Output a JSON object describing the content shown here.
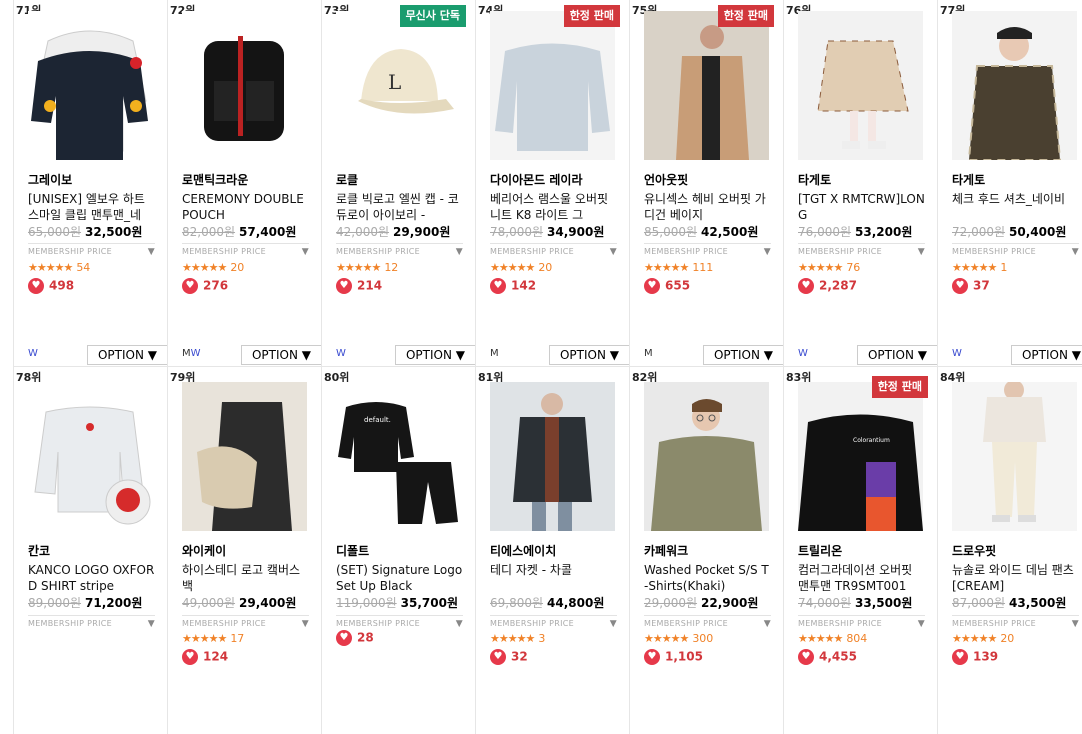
{
  "membership_label": "MEMBERSHIP PRICE",
  "option_label": "OPTION ▼",
  "row1": [
    {
      "rank": "71위",
      "brand": "그레이보",
      "name": "[UNISEX] 엘보우 하트 스마일 클립 맨투맨_네",
      "old_price": "65,000원",
      "price": "32,500원",
      "stars": "★★★★★",
      "rating_count": "54",
      "likes": "498",
      "badge": "",
      "gender_m": "",
      "gender_w": "W"
    },
    {
      "rank": "72위",
      "brand": "로맨틱크라운",
      "name": "CEREMONY DOUBLE POUCH",
      "old_price": "82,000원",
      "price": "57,400원",
      "stars": "★★★★★",
      "rating_count": "20",
      "likes": "276",
      "badge": "",
      "gender_m": "M",
      "gender_w": "W"
    },
    {
      "rank": "73위",
      "brand": "로클",
      "name": "로클 빅로고 엘씬 캡 - 코듀로이 아이보리 -",
      "old_price": "42,000원",
      "price": "29,900원",
      "stars": "★★★★★",
      "rating_count": "12",
      "likes": "214",
      "badge": "무신사 단독",
      "gender_m": "",
      "gender_w": "W"
    },
    {
      "rank": "74위",
      "brand": "다이아몬드 레이라",
      "name": "베리어스 램스울 오버핏 니트 K8 라이트 그",
      "old_price": "78,000원",
      "price": "34,900원",
      "stars": "★★★★★",
      "rating_count": "20",
      "likes": "142",
      "badge": "한정 판매",
      "gender_m": "M",
      "gender_w": ""
    },
    {
      "rank": "75위",
      "brand": "언아웃핏",
      "name": "유니섹스 헤비 오버핏 가디건 베이지",
      "old_price": "85,000원",
      "price": "42,500원",
      "stars": "★★★★★",
      "rating_count": "111",
      "likes": "655",
      "badge": "한정 판매",
      "gender_m": "M",
      "gender_w": ""
    },
    {
      "rank": "76위",
      "brand": "타게토",
      "name": "[TGT X RMTCRW]LONG",
      "old_price": "76,000원",
      "price": "53,200원",
      "stars": "★★★★★",
      "rating_count": "76",
      "likes": "2,287",
      "badge": "",
      "gender_m": "",
      "gender_w": "W"
    },
    {
      "rank": "77위",
      "brand": "타게토",
      "name": "체크 후드 셔츠_네이비",
      "old_price": "72,000원",
      "price": "50,400원",
      "stars": "★★★★★",
      "rating_count": "1",
      "likes": "37",
      "badge": "",
      "gender_m": "",
      "gender_w": "W"
    }
  ],
  "row2": [
    {
      "rank": "78위",
      "brand": "칸코",
      "name": "KANCO LOGO OXFORD SHIRT stripe",
      "old_price": "89,000원",
      "price": "71,200원",
      "stars": "",
      "rating_count": "",
      "likes": "",
      "badge": ""
    },
    {
      "rank": "79위",
      "brand": "와이케이",
      "name": "하이스테디 로고 캨버스 백",
      "old_price": "49,000원",
      "price": "29,400원",
      "stars": "★★★★★",
      "rating_count": "17",
      "likes": "124",
      "badge": ""
    },
    {
      "rank": "80위",
      "brand": "디폴트",
      "name": "(SET) Signature Logo Set Up Black",
      "old_price": "119,000원",
      "price": "35,700원",
      "stars": "",
      "rating_count": "",
      "likes": "28",
      "badge": ""
    },
    {
      "rank": "81위",
      "brand": "티에스에이치",
      "name": "테디 자켓 - 차콜",
      "old_price": "69,800원",
      "price": "44,800원",
      "stars": "★★★★★",
      "rating_count": "3",
      "likes": "32",
      "badge": ""
    },
    {
      "rank": "82위",
      "brand": "카페워크",
      "name": "Washed Pocket S/S T-Shirts(Khaki)",
      "old_price": "29,000원",
      "price": "22,900원",
      "stars": "★★★★★",
      "rating_count": "300",
      "likes": "1,105",
      "badge": ""
    },
    {
      "rank": "83위",
      "brand": "트릴리온",
      "name": "컴러그라데이션 오버핏 맨투맨 TR9SMT001",
      "old_price": "74,000원",
      "price": "33,500원",
      "stars": "★★★★★",
      "rating_count": "804",
      "likes": "4,455",
      "badge": "한정 판매"
    },
    {
      "rank": "84위",
      "brand": "드로우핏",
      "name": "뉴솔로 와이드 데님 팬츠 [CREAM]",
      "old_price": "87,000원",
      "price": "43,500원",
      "stars": "★★★★★",
      "rating_count": "20",
      "likes": "139",
      "badge": ""
    }
  ],
  "colors": {
    "sale_badge": "#d2373c",
    "exclusive_badge": "#1a9c6e",
    "star": "#f08228",
    "heart": "#e6394a",
    "gender_w": "#3a4bd0"
  }
}
